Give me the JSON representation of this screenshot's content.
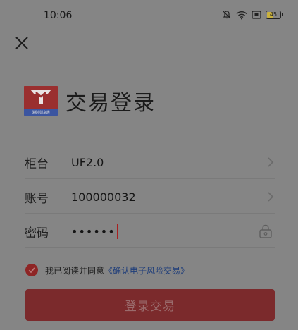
{
  "status_bar": {
    "time": "10:06",
    "battery": "45",
    "icons": [
      "mute-bell-icon",
      "wifi-icon",
      "sim-icon",
      "battery-icon"
    ]
  },
  "header": {
    "close_icon": "close-icon"
  },
  "brand": {
    "logo_icon": "brand-logo",
    "logo_text": "湘财·财富通",
    "title": "交易登录"
  },
  "form": {
    "counter": {
      "label": "柜台",
      "value": "UF2.0"
    },
    "account": {
      "label": "账号",
      "value": "100000032"
    },
    "password": {
      "label": "密码",
      "value": "••••••"
    }
  },
  "agreement": {
    "checked": true,
    "text": "我已阅读并同意",
    "link": "《确认电子风险交易》"
  },
  "login_button": {
    "label": "登录交易"
  },
  "colors": {
    "overlay_bg": "#858585",
    "accent": "#7b2a2c",
    "link": "#1e3d7a"
  }
}
